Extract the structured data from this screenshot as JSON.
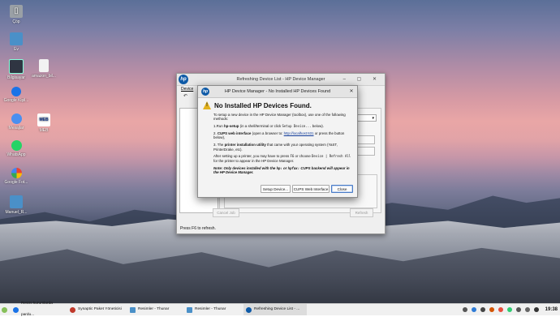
{
  "desktop": {
    "icons": [
      {
        "label": "Çöp",
        "glyph": "🗑",
        "color": "#8a8a8a"
      },
      {
        "label": "Ev",
        "glyph": "■",
        "color": "#4a90c8"
      },
      {
        "label": "Bilgisayar",
        "glyph": "▭",
        "color": "#333333"
      },
      {
        "label": "amazon_bil...",
        "glyph": "▤",
        "color": "#e8e8e8"
      },
      {
        "label": "Google Kişil...",
        "glyph": "●",
        "color": "#1a73e8"
      },
      {
        "label": "Mesajlar",
        "glyph": "●",
        "color": "#4a8ff0"
      },
      {
        "label": "MEB",
        "glyph": "M",
        "color": "#ffffff"
      },
      {
        "label": "WhatsApp",
        "glyph": "●",
        "color": "#25d366"
      },
      {
        "label": "Google Fot...",
        "glyph": "✿",
        "color": "#f4b400"
      },
      {
        "label": "Manuel_R...",
        "glyph": "■",
        "color": "#4a90c8"
      }
    ]
  },
  "bg_window": {
    "title": "Refreshing Device List - HP Device Manager",
    "menu": "Device",
    "controls": "–  ▢  ✕",
    "cancel_label": "Cancel Job",
    "refresh_label": "Refresh",
    "status": "Press F6 to refresh."
  },
  "dialog": {
    "title": "HP Device Manager - No Installed HP Devices Found",
    "logo": "hp",
    "heading": "No Installed HP Devices Found.",
    "intro": "To setup a new device in the HP Device Manager (toolbox), use one of the following methods:",
    "step1_pre": "1.Run ",
    "step1_bold": "hp-setup",
    "step1_mid": " (in a shell/terminal or click ",
    "step1_code": "Setup Device...",
    "step1_post": " below).",
    "step2_pre": "2. ",
    "step2_bold": "CUPS web interface",
    "step2_mid": " (open a browser to: ",
    "step2_link": "http://localhost:631",
    "step2_post": " or press the button below),",
    "step3_pre": "3. The ",
    "step3_bold": "printer installation utility",
    "step3_post": " that came with your operating system (YaST, PrinterDrake, etc).",
    "after_pre": "After setting up a printer, you may have to press ",
    "after_code1": "F6",
    "after_mid": " or choose ",
    "after_code2": "Device | Refresh All",
    "after_post": " for the printer to appear in the HP Device Manager.",
    "note_pre": "Note: Only devices installed with the ",
    "note_code1": "hp:",
    "note_mid": " or ",
    "note_code2": "hpfax:",
    "note_post": " CUPS backend will appear in the HP Device Manager.",
    "btn_setup": "Setup Device...",
    "btn_cups": "CUPS Web Interface",
    "btn_close": "Close"
  },
  "taskbar": {
    "items": [
      {
        "label": "Resmi kurumlarda pardu...",
        "color": "#1a73e8"
      },
      {
        "label": "Synaptic Paket Yöneticisi",
        "color": "#c0392b"
      },
      {
        "label": "Resimler - Thunar",
        "color": "#4a90c8"
      },
      {
        "label": "Resimler - Thunar",
        "color": "#4a90c8"
      },
      {
        "label": "Refreshing Device List - ...",
        "color": "#0e5aa7"
      }
    ],
    "tray_colors": [
      "#555555",
      "#2e7bd6",
      "#444444",
      "#d35400",
      "#e74c3c",
      "#2ecc71",
      "#555555",
      "#666666",
      "#333333"
    ],
    "clock": "19:38"
  }
}
